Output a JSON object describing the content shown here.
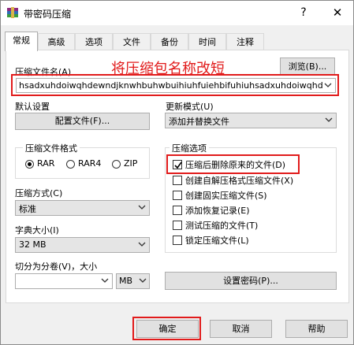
{
  "window": {
    "title": "带密码压缩",
    "help_glyph": "?",
    "close_glyph": "✕"
  },
  "tabs": [
    "常规",
    "高级",
    "选项",
    "文件",
    "备份",
    "时间",
    "注释"
  ],
  "archive": {
    "label": "压缩文件名(A)",
    "annotation": "将压缩包名称改短",
    "browse_label": "浏览(B)...",
    "filename": "hsadxuhdoiwqhdewndjknwhbuhwbuihiuhfuiehbifuhiuhsadxuhdoiwqhdewndjknw"
  },
  "default_settings": {
    "label": "默认设置",
    "profiles_button": "配置文件(F)..."
  },
  "update_mode": {
    "label": "更新模式(U)",
    "value": "添加并替换文件"
  },
  "format": {
    "label": "压缩文件格式",
    "options": [
      "RAR",
      "RAR4",
      "ZIP"
    ],
    "selected": "RAR"
  },
  "method": {
    "label": "压缩方式(C)",
    "value": "标准"
  },
  "dictionary": {
    "label": "字典大小(I)",
    "value": "32 MB"
  },
  "split": {
    "label": "切分为分卷(V)，大小",
    "unit": "MB"
  },
  "options": {
    "label": "压缩选项",
    "items": [
      {
        "label": "压缩后删除原来的文件(D)",
        "checked": true
      },
      {
        "label": "创建自解压格式压缩文件(X)",
        "checked": false
      },
      {
        "label": "创建固实压缩文件(S)",
        "checked": false
      },
      {
        "label": "添加恢复记录(E)",
        "checked": false
      },
      {
        "label": "测试压缩的文件(T)",
        "checked": false
      },
      {
        "label": "锁定压缩文件(L)",
        "checked": false
      }
    ]
  },
  "password_button": "设置密码(P)...",
  "footer": {
    "ok": "确定",
    "cancel": "取消",
    "help": "帮助"
  },
  "colors": {
    "highlight": "#e11b1b",
    "accent": "#0078d7"
  }
}
